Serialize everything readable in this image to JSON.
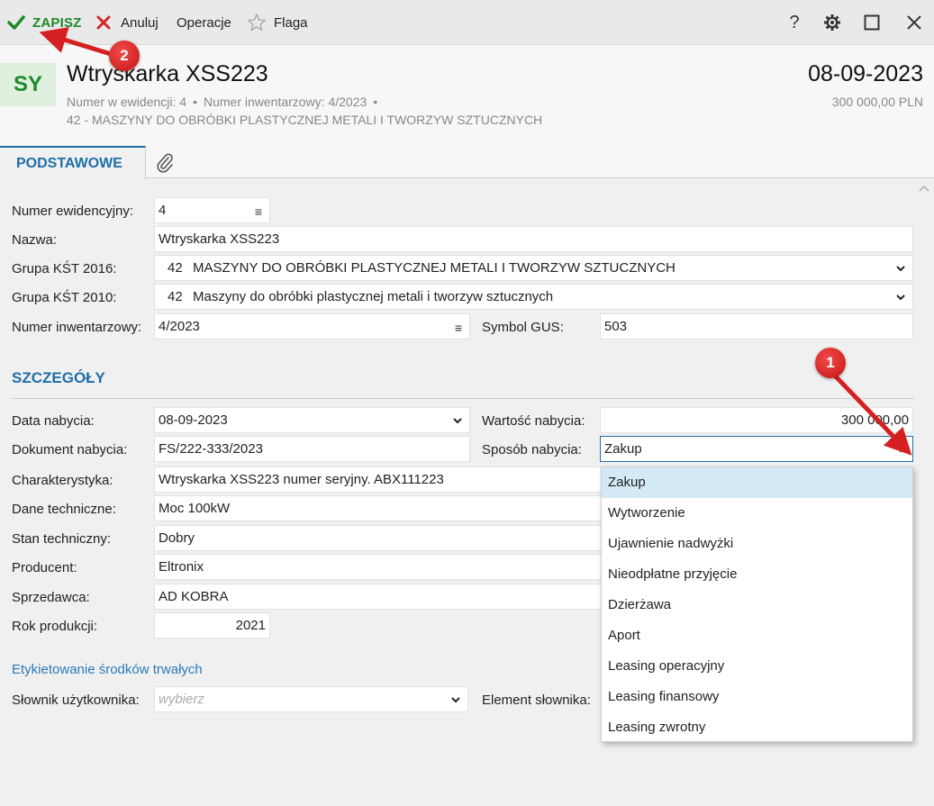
{
  "toolbar": {
    "save_label": "ZAPISZ",
    "cancel_label": "Anuluj",
    "operations_label": "Operacje",
    "flag_label": "Flaga",
    "help_label": "?"
  },
  "header": {
    "avatar_text": "SY",
    "title": "Wtryskarka XSS223",
    "record_number": "Numer w ewidencji: 4",
    "inventory_number": "Numer inwentarzowy: 4/2023",
    "bullet": "•",
    "category": "42 - MASZYNY DO OBRÓBKI PLASTYCZNEJ METALI I TWORZYW SZTUCZNYCH",
    "date": "08-09-2023",
    "amount": "300 000,00 PLN"
  },
  "tabs": {
    "basic_label": "PODSTAWOWE"
  },
  "form": {
    "record_number_label": "Numer ewidencyjny:",
    "record_number_value": "4",
    "name_label": "Nazwa:",
    "name_value": "Wtryskarka XSS223",
    "kst2016_label": "Grupa KŚT 2016:",
    "kst2016_code": "42",
    "kst2016_value": "MASZYNY DO OBRÓBKI PLASTYCZNEJ METALI I TWORZYW SZTUCZNYCH",
    "kst2010_label": "Grupa KŚT 2010:",
    "kst2010_code": "42",
    "kst2010_value": "Maszyny do obróbki plastycznej metali i tworzyw sztucznych",
    "inventory_label": "Numer inwentarzowy:",
    "inventory_value": "4/2023",
    "gus_label": "Symbol GUS:",
    "gus_value": "503"
  },
  "details": {
    "title": "SZCZEGÓŁY",
    "acq_date_label": "Data nabycia:",
    "acq_date_value": "08-09-2023",
    "acq_value_label": "Wartość nabycia:",
    "acq_value_value": "300 000,00",
    "acq_doc_label": "Dokument nabycia:",
    "acq_doc_value": "FS/222-333/2023",
    "acq_method_label": "Sposób nabycia:",
    "acq_method_value": "Zakup",
    "characteristic_label": "Charakterystyka:",
    "characteristic_value": "Wtryskarka XSS223 numer seryjny. ABX111223",
    "technical_label": "Dane techniczne:",
    "technical_value": "Moc 100kW",
    "condition_label": "Stan techniczny:",
    "condition_value": "Dobry",
    "producer_label": "Producent:",
    "producer_value": "Eltronix",
    "seller_label": "Sprzedawca:",
    "seller_value": "AD KOBRA",
    "year_label": "Rok produkcji:",
    "year_value": "2021"
  },
  "labels_section": {
    "title": "Etykietowanie środków trwałych",
    "dictionary_label": "Słownik użytkownika:",
    "dictionary_placeholder": "wybierz",
    "element_label": "Element słownika:"
  },
  "dropdown": {
    "options": [
      "Zakup",
      "Wytworzenie",
      "Ujawnienie nadwyżki",
      "Nieodpłatne przyjęcie",
      "Dzierżawa",
      "Aport",
      "Leasing operacyjny",
      "Leasing finansowy",
      "Leasing zwrotny"
    ],
    "selected": "Zakup"
  },
  "annotations": {
    "badge1": "1",
    "badge2": "2"
  },
  "colors": {
    "accent": "#1f6fa8",
    "save_green": "#1d8a2a",
    "annotation_red": "#d42020"
  }
}
